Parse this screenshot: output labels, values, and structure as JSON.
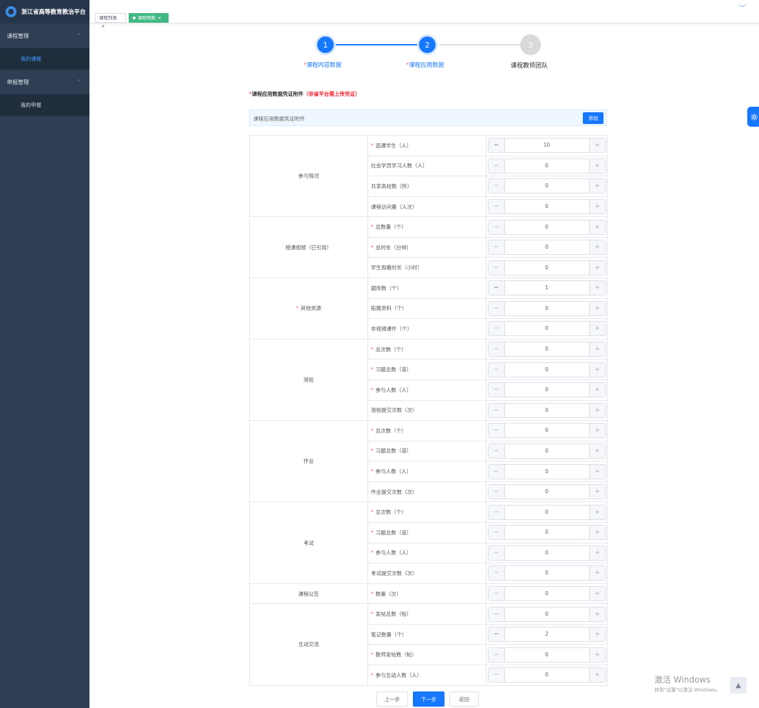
{
  "app": {
    "title": "浙江省高等教育教治平台"
  },
  "sidebar": {
    "groups": [
      {
        "label": "课程管理",
        "chevron": "^",
        "items": [
          {
            "label": "我的课程",
            "active": true
          }
        ]
      },
      {
        "label": "申报管理",
        "chevron": "^",
        "items": [
          {
            "label": "我的申报",
            "active": false
          }
        ]
      }
    ]
  },
  "tabs": [
    {
      "label": "课程列表",
      "close": "×",
      "active": false
    },
    {
      "label": "课程明数",
      "close": "×",
      "active": true
    }
  ],
  "steps": [
    {
      "number": "1",
      "label": "课程内容数据",
      "required": "*",
      "status": "done"
    },
    {
      "number": "2",
      "label": "课程应用数据",
      "required": "*",
      "status": "done"
    },
    {
      "number": "3",
      "label": "课程教师团队",
      "required": "",
      "status": "todo"
    }
  ],
  "attachment": {
    "required": "*",
    "title": "课程应用数据凭证附件",
    "note": "（非省平台需上传凭证）",
    "placeholder": "课程应用数据凭证附件",
    "add_label": "添加"
  },
  "table": {
    "groups": [
      {
        "category": "参与情况",
        "cat_required": false,
        "rows": [
          {
            "label": "选课学生（人）",
            "required": true,
            "value": "10"
          },
          {
            "label": "社会学员学习人数（人）",
            "required": false,
            "value": "0"
          },
          {
            "label": "共享高校数（所）",
            "required": false,
            "value": "0"
          },
          {
            "label": "课程访问量（人次）",
            "required": false,
            "value": "0"
          }
        ]
      },
      {
        "category": "授课视频（已引用）",
        "cat_required": false,
        "rows": [
          {
            "label": "总数量（个）",
            "required": true,
            "value": "0"
          },
          {
            "label": "总时长（分钟）",
            "required": true,
            "value": "0"
          },
          {
            "label": "学生观看时长（小时）",
            "required": false,
            "value": "0"
          }
        ]
      },
      {
        "category": "其他资源",
        "cat_required": true,
        "rows": [
          {
            "label": "题库数（个）",
            "required": false,
            "value": "1"
          },
          {
            "label": "拓展资料（个）",
            "required": false,
            "value": "0"
          },
          {
            "label": "非视频课件（个）",
            "required": false,
            "value": "0"
          }
        ]
      },
      {
        "category": "测验",
        "cat_required": false,
        "rows": [
          {
            "label": "总次数（个）",
            "required": true,
            "value": "0"
          },
          {
            "label": "习题总数（道）",
            "required": true,
            "value": "0"
          },
          {
            "label": "参与人数（人）",
            "required": true,
            "value": "0"
          },
          {
            "label": "测验提交次数（次）",
            "required": false,
            "value": "0"
          }
        ]
      },
      {
        "category": "作业",
        "cat_required": false,
        "rows": [
          {
            "label": "总次数（个）",
            "required": true,
            "value": "0"
          },
          {
            "label": "习题总数（道）",
            "required": true,
            "value": "0"
          },
          {
            "label": "参与人数（人）",
            "required": true,
            "value": "0"
          },
          {
            "label": "作业提交次数（次）",
            "required": false,
            "value": "0"
          }
        ]
      },
      {
        "category": "考试",
        "cat_required": false,
        "rows": [
          {
            "label": "总次数（个）",
            "required": true,
            "value": "0"
          },
          {
            "label": "习题总数（道）",
            "required": true,
            "value": "0"
          },
          {
            "label": "参与人数（人）",
            "required": true,
            "value": "0"
          },
          {
            "label": "考试提交次数（次）",
            "required": false,
            "value": "0"
          }
        ]
      },
      {
        "category": "课程公告",
        "cat_required": false,
        "rows": [
          {
            "label": "数量（次）",
            "required": true,
            "value": "0"
          }
        ]
      },
      {
        "category": "互动交流",
        "cat_required": false,
        "rows": [
          {
            "label": "发帖总数（帖）",
            "required": true,
            "value": "0"
          },
          {
            "label": "笔记数量（个）",
            "required": false,
            "value": "2"
          },
          {
            "label": "教师发帖数（帖）",
            "required": true,
            "value": "0"
          },
          {
            "label": "参与互动人数（人）",
            "required": true,
            "value": "0"
          }
        ]
      }
    ]
  },
  "footer": {
    "prev_label": "上一步",
    "next_label": "下一步",
    "back_label": "返回"
  },
  "watermark": {
    "line1": "激活 Windows",
    "line2": "转到\"设置\"以激活 Windows。"
  },
  "colors": {
    "primary": "#1677ff",
    "sidebar_bg": "#2f3e53",
    "active_tab": "#42b983",
    "required": "#f56c6c"
  }
}
